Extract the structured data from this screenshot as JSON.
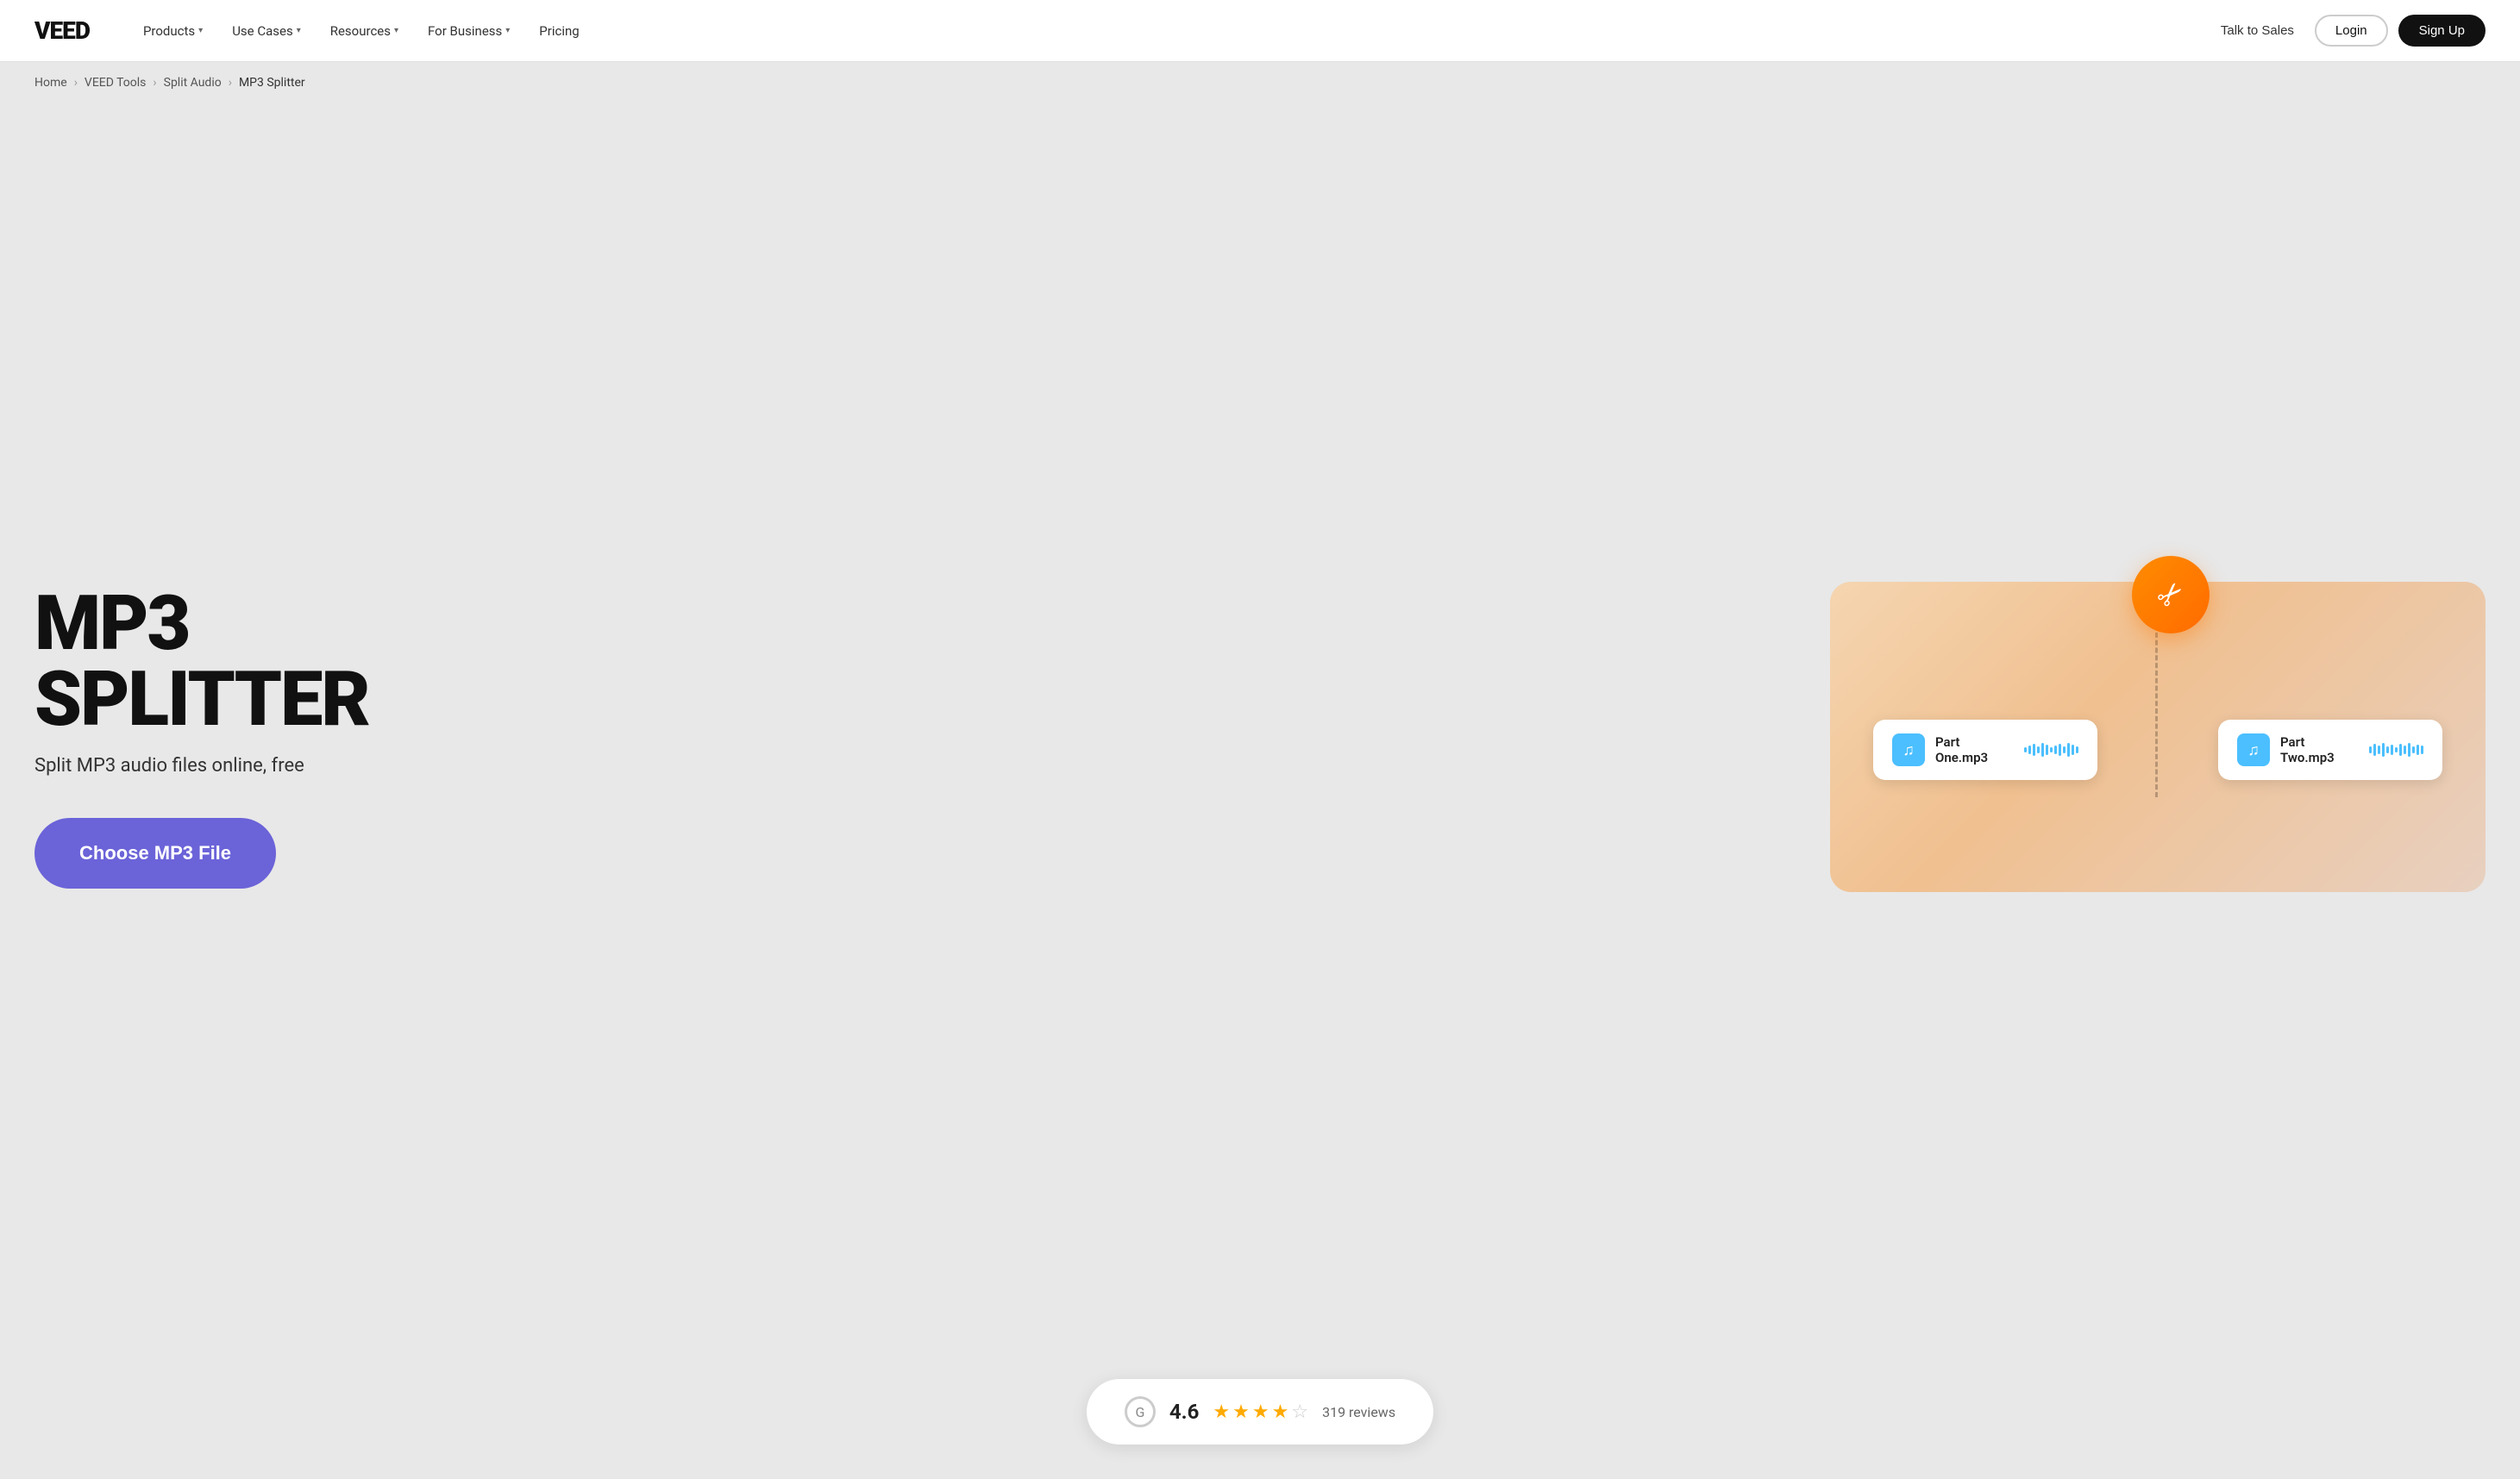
{
  "nav": {
    "logo": "VEED",
    "links": [
      {
        "label": "Products",
        "hasChevron": true
      },
      {
        "label": "Use Cases",
        "hasChevron": true
      },
      {
        "label": "Resources",
        "hasChevron": true
      },
      {
        "label": "For Business",
        "hasChevron": true
      },
      {
        "label": "Pricing",
        "hasChevron": false
      }
    ],
    "talk_to_sales": "Talk to Sales",
    "login": "Login",
    "signup": "Sign Up"
  },
  "breadcrumb": {
    "items": [
      "Home",
      "VEED Tools",
      "Split Audio",
      "MP3 Splitter"
    ]
  },
  "hero": {
    "title": "MP3 SPLITTER",
    "subtitle": "Split MP3 audio files online, free",
    "cta": "Choose MP3 File"
  },
  "illustration": {
    "card_left": "Part One.mp3",
    "card_right": "Part Two.mp3",
    "scissors_symbol": "✂"
  },
  "rating": {
    "score": "4.6",
    "stars": [
      true,
      true,
      true,
      true,
      false
    ],
    "half_star_index": 3,
    "review_count": "319 reviews"
  },
  "waveform_heights_left": [
    6,
    10,
    14,
    8,
    16,
    12,
    6,
    10,
    14,
    8,
    16,
    12,
    8
  ],
  "waveform_heights_right": [
    8,
    14,
    10,
    16,
    8,
    12,
    6,
    14,
    10,
    16,
    8,
    12,
    10
  ]
}
